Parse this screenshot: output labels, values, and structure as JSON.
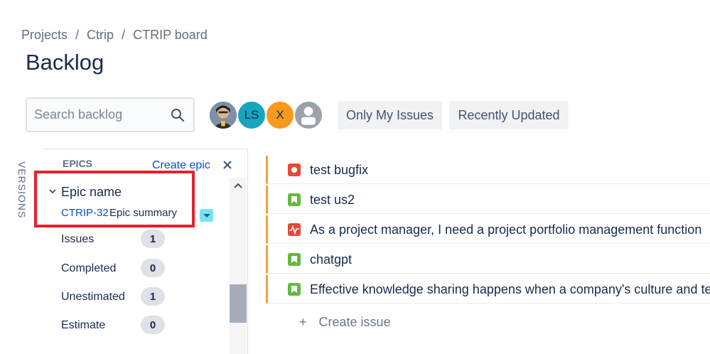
{
  "breadcrumb": {
    "items": [
      "Projects",
      "Ctrip",
      "CTRIP board"
    ],
    "separator": "/"
  },
  "page": {
    "title": "Backlog"
  },
  "search": {
    "placeholder": "Search backlog",
    "icon": "search-icon"
  },
  "avatars": [
    {
      "name": "photo-avatar",
      "initials": ""
    },
    {
      "name": "ls",
      "initials": "LS",
      "color": "#16a5bf"
    },
    {
      "name": "x",
      "initials": "X",
      "color": "#f79a1c"
    },
    {
      "name": "unknown",
      "initials": "",
      "color": "#9aa0ac"
    }
  ],
  "filters": {
    "only_my_issues": "Only My Issues",
    "recently_updated": "Recently Updated"
  },
  "side_tabs": {
    "versions": "VERSIONS"
  },
  "epics_panel": {
    "header": "EPICS",
    "create_epic": "Create epic",
    "epic": {
      "name": "Epic name",
      "key": "CTRIP-32",
      "summary": "Epic summary"
    },
    "stats": [
      {
        "label": "Issues",
        "value": "1"
      },
      {
        "label": "Completed",
        "value": "0"
      },
      {
        "label": "Unestimated",
        "value": "1"
      },
      {
        "label": "Estimate",
        "value": "0"
      }
    ]
  },
  "issues": [
    {
      "type": "bug",
      "summary": "test bugfix"
    },
    {
      "type": "story",
      "summary": "test us2"
    },
    {
      "type": "pulse",
      "summary": "As a project manager, I need a project portfolio management function"
    },
    {
      "type": "story",
      "summary": "chatgpt"
    },
    {
      "type": "story",
      "summary": "Effective knowledge sharing happens when a company's culture and te"
    }
  ],
  "create_issue": {
    "plus": "+",
    "label": "Create issue"
  },
  "colors": {
    "accent": "#0052cc",
    "epic_border": "#f2a33a",
    "highlight": "#e3222c",
    "epic_badge": "#79e2f2"
  }
}
